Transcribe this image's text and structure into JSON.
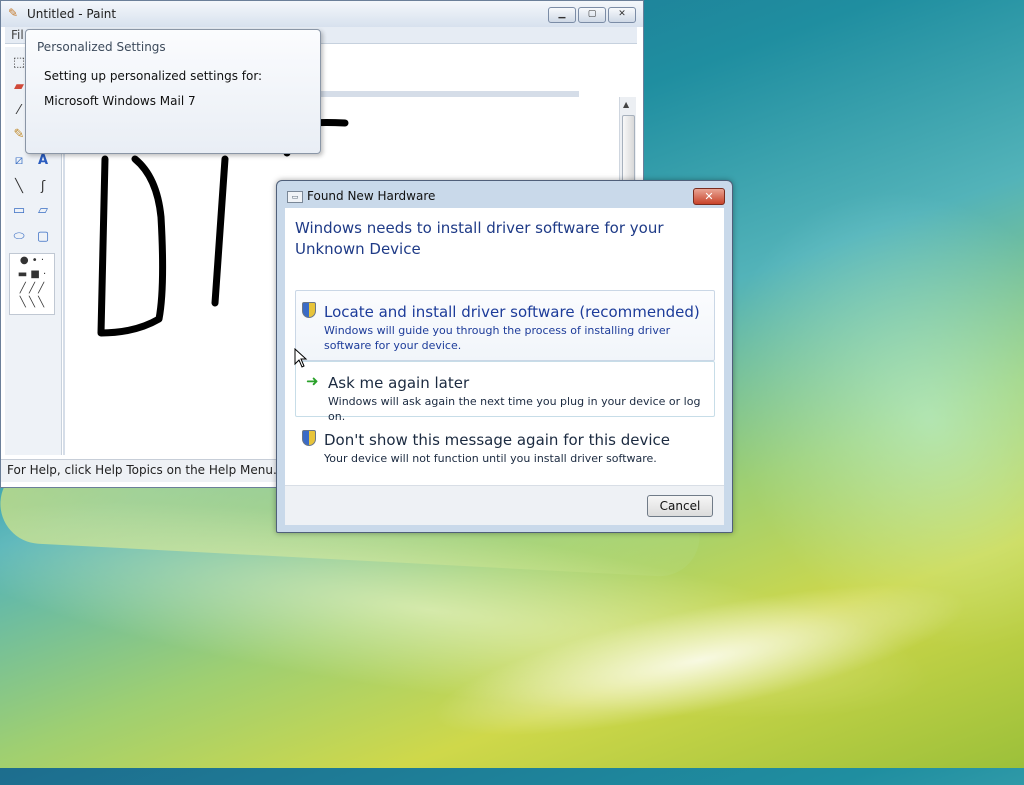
{
  "paint": {
    "title": "Untitled - Paint",
    "menu_file": "Fil",
    "status": "For Help, click Help Topics on the Help Menu."
  },
  "balloon": {
    "title": "Personalized Settings",
    "line1": "Setting up personalized settings for:",
    "line2": "Microsoft Windows Mail 7"
  },
  "dialog": {
    "title": "Found New Hardware",
    "heading": "Windows needs to install driver software for your Unknown Device",
    "options": [
      {
        "title": "Locate and install driver software (recommended)",
        "desc": "Windows will guide you through the process of installing driver software for your device.",
        "icon": "shield-icon"
      },
      {
        "title": "Ask me again later",
        "desc": "Windows will ask again the next time you plug in your device or log on.",
        "icon": "green-arrow-icon"
      },
      {
        "title": "Don't show this message again for this device",
        "desc": "Your device will not function until you install driver software.",
        "icon": "shield-icon"
      }
    ],
    "cancel_label": "Cancel"
  }
}
